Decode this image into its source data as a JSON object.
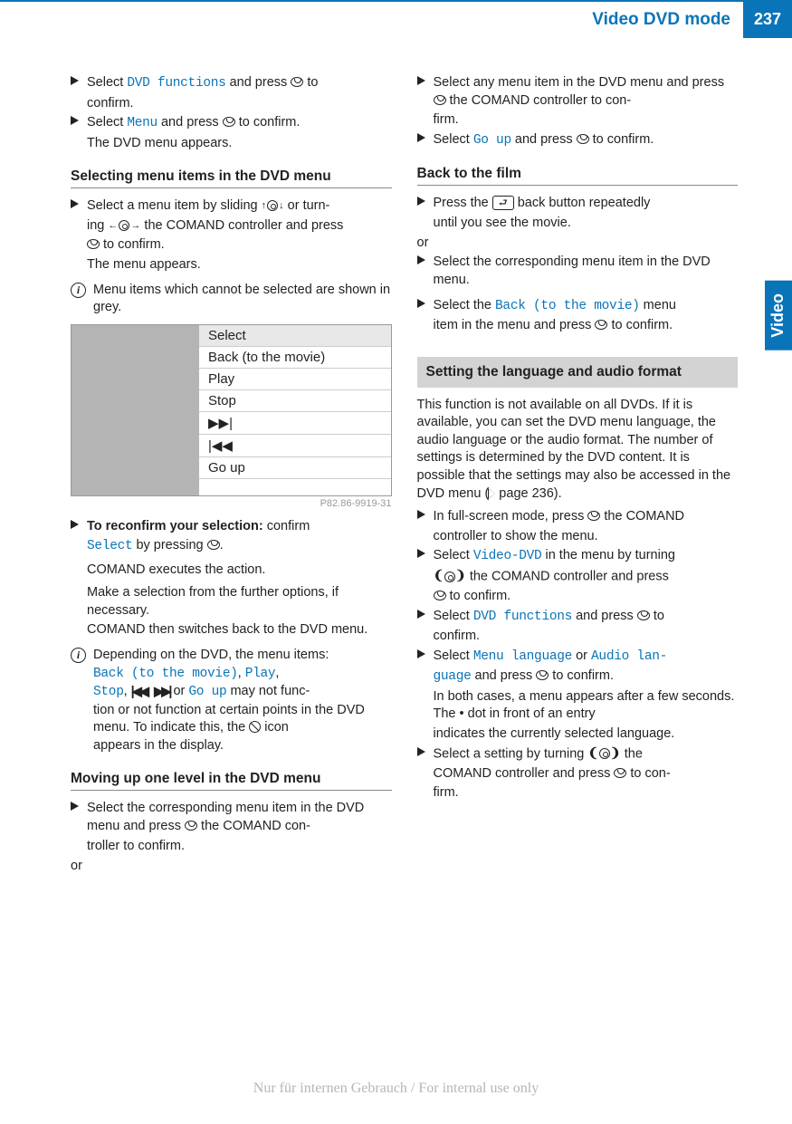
{
  "header": {
    "title": "Video DVD mode",
    "page": "237"
  },
  "side_tab": "Video",
  "left": {
    "b1a": "Select ",
    "b1_ui": "DVD functions",
    "b1b": " and press ",
    "b1c": " to",
    "b1d": "confirm.",
    "b2a": "Select ",
    "b2_ui": "Menu",
    "b2b": " and press ",
    "b2c": " to confirm.",
    "b2d": "The DVD menu appears.",
    "h1": "Selecting menu items in the DVD menu",
    "b3a": "Select a menu item by sliding ",
    "b3b": " or turn-",
    "b3c": "ing ",
    "b3d": " the COMAND controller and press",
    "b3e": " to confirm.",
    "b3f": "The menu appears.",
    "info1": "Menu items which cannot be selected are shown in grey.",
    "menu": [
      "Select",
      "Back (to the movie)",
      "Play",
      "Stop",
      "▶▶|",
      "|◀◀",
      "Go up"
    ],
    "caption": "P82.86-9919-31",
    "b4a": "To reconfirm your selection:",
    "b4b": " confirm",
    "b4_ui": "Select",
    "b4c": " by pressing ",
    "b4d": ".",
    "b4e": "COMAND executes the action.",
    "b4f": "Make a selection from the further options, if necessary.",
    "b4g": "COMAND then switches back to the DVD menu.",
    "info2a": "Depending on the DVD, the menu items:",
    "info2_ui1": "Back (to the movie)",
    "info2_ui2": "Play",
    "info2_ui3": "Stop",
    "info2_ui4": "Go up",
    "info2b": " may not func-",
    "info2c": "tion or not function at certain points in the DVD menu. To indicate this, the ",
    "info2d": " icon",
    "info2e": "appears in the display.",
    "h2": "Moving up one level in the DVD menu",
    "b5a": "Select the corresponding menu item in the DVD menu and press ",
    "b5b": " the COMAND con-",
    "b5c": "troller to confirm.",
    "or1": "or"
  },
  "right": {
    "b1a": "Select any menu item in the DVD menu and press ",
    "b1b": " the COMAND controller to con-",
    "b1c": "firm.",
    "b2a": "Select ",
    "b2_ui": "Go up",
    "b2b": " and press ",
    "b2c": " to confirm.",
    "h1": "Back to the film",
    "b3a": "Press the ",
    "b3b": " back button repeatedly",
    "b3c": "until you see the movie.",
    "or1": "or",
    "b4a": "Select the corresponding menu item in the DVD menu.",
    "b5a": "Select the ",
    "b5_ui": "Back (to the movie)",
    "b5b": " menu",
    "b5c": "item in the menu and press ",
    "b5d": " to confirm.",
    "hbox": "Setting the language and audio format",
    "p1": "This function is not available on all DVDs. If it is available, you can set the DVD menu language, the audio language or the audio format. The number of settings is determined by the DVD content. It is possible that the settings may also be accessed in the DVD menu (",
    "p1b": " page 236).",
    "b6a": "In full-screen mode, press ",
    "b6b": " the COMAND",
    "b6c": "controller to show the menu.",
    "b7a": "Select ",
    "b7_ui": "Video-DVD",
    "b7b": " in the menu by turning",
    "b7c": " the COMAND controller and press",
    "b7d": " to confirm.",
    "b8a": "Select ",
    "b8_ui": "DVD functions",
    "b8b": " and press ",
    "b8c": " to",
    "b8d": "confirm.",
    "b9a": "Select ",
    "b9_ui1": "Menu language",
    "b9b": " or ",
    "b9_ui2": "Audio lan-",
    "b9_ui2b": "guage",
    "b9c": " and press ",
    "b9d": " to confirm.",
    "b9e": "In both cases, a menu appears after a few seconds. The ",
    "b9f": " dot in front of an entry",
    "b9g": "indicates the currently selected language.",
    "b10a": "Select a setting by turning ",
    "b10b": " the",
    "b10c": "COMAND controller and press ",
    "b10d": " to con-",
    "b10e": "firm."
  },
  "watermark": "Nur für internen Gebrauch / For internal use only"
}
